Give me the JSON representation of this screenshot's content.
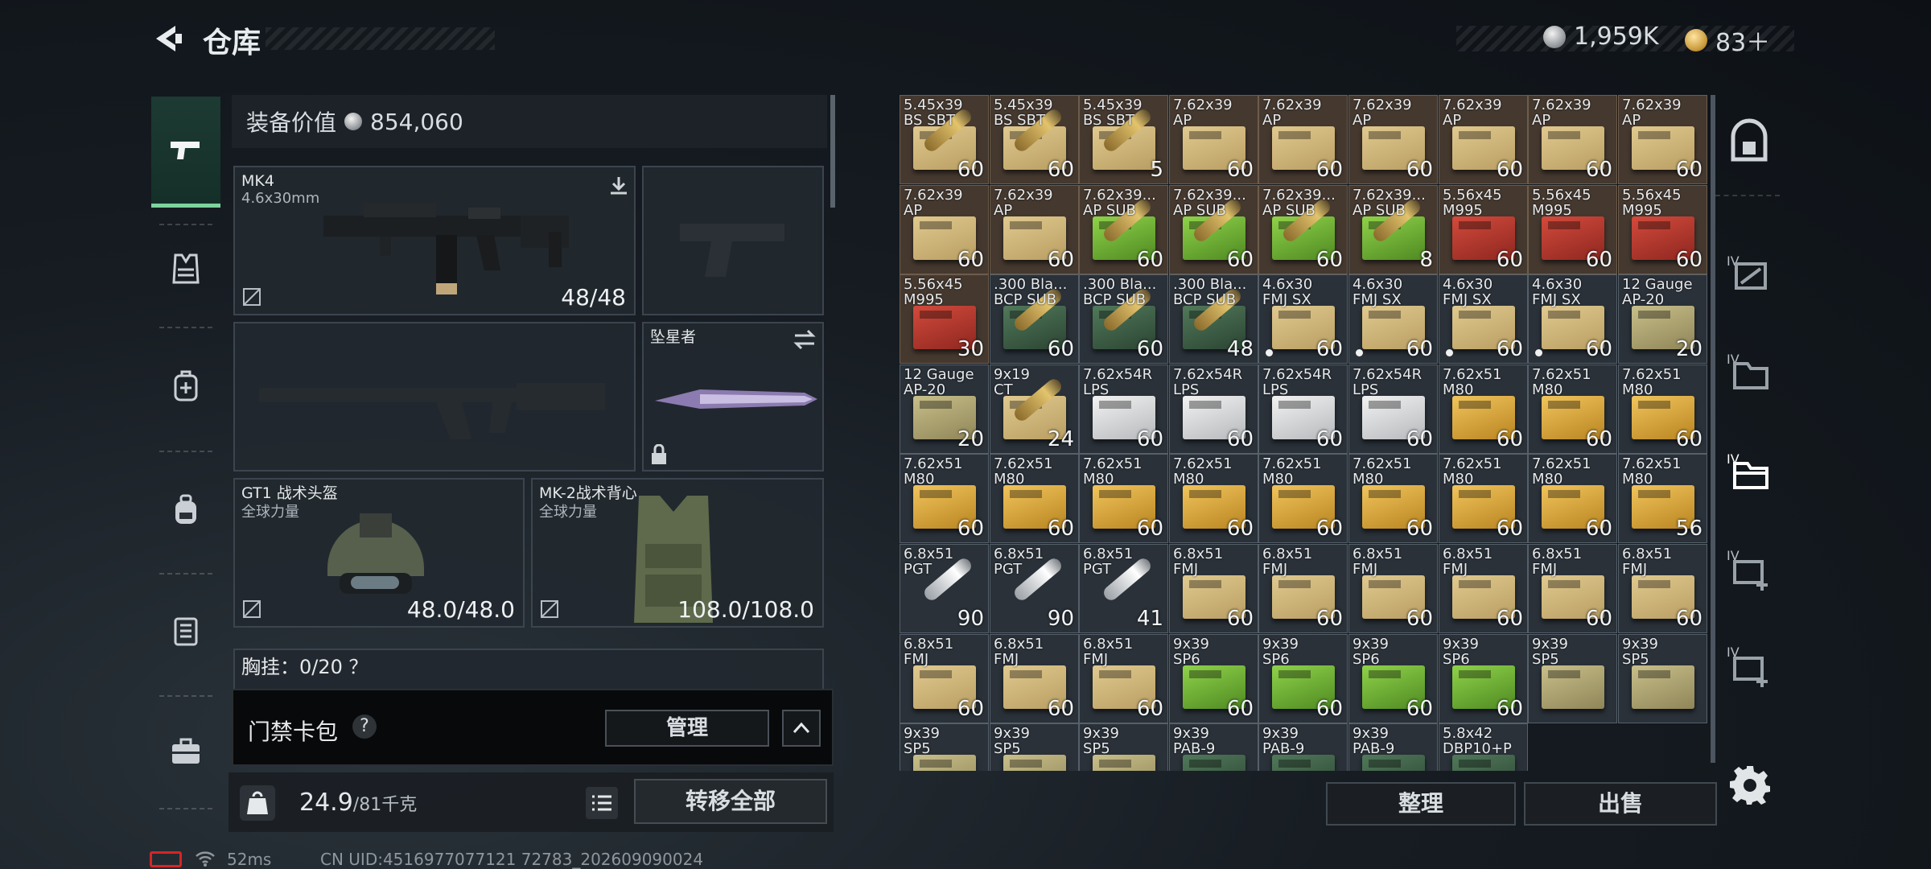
{
  "header": {
    "title": "仓库",
    "currency": [
      {
        "icon": "silver-coin-icon",
        "value": "1,959K"
      },
      {
        "icon": "gold-coin-icon",
        "value": "83＋"
      }
    ]
  },
  "left_nav": [
    {
      "icon": "pistol-icon",
      "selected": true
    },
    {
      "icon": "vest-icon"
    },
    {
      "icon": "backpack-medical-icon"
    },
    {
      "icon": "backpack-icon"
    },
    {
      "icon": "container-icon"
    },
    {
      "icon": "case-icon"
    }
  ],
  "equipment": {
    "value_label": "装备价值",
    "value": "854,060",
    "primary": {
      "name": "MK4",
      "caliber": "4.6x30mm",
      "ammo": "48/48"
    },
    "melee": {
      "name": "坠星者"
    },
    "helmet": {
      "name": "GT1 战术头盔",
      "brand": "全球力量",
      "durability": "48.0/48.0"
    },
    "armor": {
      "name": "MK-2战术背心",
      "brand": "全球力量",
      "durability": "108.0/108.0"
    },
    "chest_partial": "胸挂：0/20  ？"
  },
  "card_bag": {
    "label": "门禁卡包",
    "help": "?",
    "manage": "管理"
  },
  "bottom_bar": {
    "weight": "24.9",
    "weight_cap": "/81千克",
    "transfer_all": "转移全部"
  },
  "status": {
    "ping": "52ms",
    "uid": "CN UID:4516977077121 72783_202609090024"
  },
  "inventory": [
    {
      "n": "5.45x39\nBS SBT",
      "q": "60",
      "box": "bullet",
      "hl": true
    },
    {
      "n": "5.45x39\nBS SBT",
      "q": "60",
      "box": "bullet",
      "hl": true
    },
    {
      "n": "5.45x39\nBS SBT",
      "q": "5",
      "box": "bullet",
      "hl": true
    },
    {
      "n": "7.62x39\nAP",
      "q": "60",
      "box": "tan",
      "hl": true
    },
    {
      "n": "7.62x39\nAP",
      "q": "60",
      "box": "tan",
      "hl": true
    },
    {
      "n": "7.62x39\nAP",
      "q": "60",
      "box": "tan",
      "hl": true
    },
    {
      "n": "7.62x39\nAP",
      "q": "60",
      "box": "tan",
      "hl": true
    },
    {
      "n": "7.62x39\nAP",
      "q": "60",
      "box": "tan",
      "hl": true
    },
    {
      "n": "7.62x39\nAP",
      "q": "60",
      "box": "tan",
      "hl": true
    },
    {
      "n": "7.62x39\nAP",
      "q": "60",
      "box": "tan",
      "hl": true
    },
    {
      "n": "7.62x39\nAP",
      "q": "60",
      "box": "tan",
      "hl": true
    },
    {
      "n": "7.62x39...\nAP SUB",
      "q": "60",
      "box": "bullet-green",
      "hl": true
    },
    {
      "n": "7.62x39...\nAP SUB",
      "q": "60",
      "box": "bullet-green",
      "hl": true
    },
    {
      "n": "7.62x39...\nAP SUB",
      "q": "60",
      "box": "bullet-green",
      "hl": true
    },
    {
      "n": "7.62x39...\nAP SUB",
      "q": "8",
      "box": "bullet-green",
      "hl": true
    },
    {
      "n": "5.56x45\nM995",
      "q": "60",
      "box": "red",
      "hl": true
    },
    {
      "n": "5.56x45\nM995",
      "q": "60",
      "box": "red",
      "hl": true
    },
    {
      "n": "5.56x45\nM995",
      "q": "60",
      "box": "red",
      "hl": true
    },
    {
      "n": "5.56x45\nM995",
      "q": "30",
      "box": "red",
      "hl": true
    },
    {
      "n": ".300 Bla...\nBCP SUB",
      "q": "60",
      "box": "bullet-dark",
      "hl": false
    },
    {
      "n": ".300 Bla...\nBCP SUB",
      "q": "60",
      "box": "bullet-dark",
      "hl": false
    },
    {
      "n": ".300 Bla...\nBCP SUB",
      "q": "48",
      "box": "bullet-dark",
      "hl": false
    },
    {
      "n": "4.6x30\nFMJ SX",
      "q": "60",
      "box": "tan",
      "hl": false,
      "dot": true
    },
    {
      "n": "4.6x30\nFMJ SX",
      "q": "60",
      "box": "tan",
      "hl": false,
      "dot": true
    },
    {
      "n": "4.6x30\nFMJ SX",
      "q": "60",
      "box": "tan",
      "hl": false,
      "dot": true
    },
    {
      "n": "4.6x30\nFMJ SX",
      "q": "60",
      "box": "tan",
      "hl": false,
      "dot": true
    },
    {
      "n": "12 Gauge\nAP-20",
      "q": "20",
      "box": "olive",
      "hl": false
    },
    {
      "n": "12 Gauge\nAP-20",
      "q": "20",
      "box": "olive",
      "hl": false
    },
    {
      "n": "9x19\nCT",
      "q": "24",
      "box": "bullet",
      "hl": false
    },
    {
      "n": "7.62x54R\nLPS",
      "q": "60",
      "box": "white",
      "hl": false
    },
    {
      "n": "7.62x54R\nLPS",
      "q": "60",
      "box": "white",
      "hl": false
    },
    {
      "n": "7.62x54R\nLPS",
      "q": "60",
      "box": "white",
      "hl": false
    },
    {
      "n": "7.62x54R\nLPS",
      "q": "60",
      "box": "white",
      "hl": false
    },
    {
      "n": "7.62x51\nM80",
      "q": "60",
      "box": "gold",
      "hl": false
    },
    {
      "n": "7.62x51\nM80",
      "q": "60",
      "box": "gold",
      "hl": false
    },
    {
      "n": "7.62x51\nM80",
      "q": "60",
      "box": "gold",
      "hl": false
    },
    {
      "n": "7.62x51\nM80",
      "q": "60",
      "box": "gold",
      "hl": false
    },
    {
      "n": "7.62x51\nM80",
      "q": "60",
      "box": "gold",
      "hl": false
    },
    {
      "n": "7.62x51\nM80",
      "q": "60",
      "box": "gold",
      "hl": false
    },
    {
      "n": "7.62x51\nM80",
      "q": "60",
      "box": "gold",
      "hl": false
    },
    {
      "n": "7.62x51\nM80",
      "q": "60",
      "box": "gold",
      "hl": false
    },
    {
      "n": "7.62x51\nM80",
      "q": "60",
      "box": "gold",
      "hl": false
    },
    {
      "n": "7.62x51\nM80",
      "q": "60",
      "box": "gold",
      "hl": false
    },
    {
      "n": "7.62x51\nM80",
      "q": "60",
      "box": "gold",
      "hl": false
    },
    {
      "n": "7.62x51\nM80",
      "q": "56",
      "box": "gold",
      "hl": false
    },
    {
      "n": "6.8x51\nPGT",
      "q": "90",
      "box": "bullet-silver",
      "hl": false
    },
    {
      "n": "6.8x51\nPGT",
      "q": "90",
      "box": "bullet-silver",
      "hl": false
    },
    {
      "n": "6.8x51\nPGT",
      "q": "41",
      "box": "bullet-silver",
      "hl": false
    },
    {
      "n": "6.8x51\nFMJ",
      "q": "60",
      "box": "tan",
      "hl": false
    },
    {
      "n": "6.8x51\nFMJ",
      "q": "60",
      "box": "tan",
      "hl": false
    },
    {
      "n": "6.8x51\nFMJ",
      "q": "60",
      "box": "tan",
      "hl": false
    },
    {
      "n": "6.8x51\nFMJ",
      "q": "60",
      "box": "tan",
      "hl": false
    },
    {
      "n": "6.8x51\nFMJ",
      "q": "60",
      "box": "tan",
      "hl": false
    },
    {
      "n": "6.8x51\nFMJ",
      "q": "60",
      "box": "tan",
      "hl": false
    },
    {
      "n": "6.8x51\nFMJ",
      "q": "60",
      "box": "tan",
      "hl": false
    },
    {
      "n": "6.8x51\nFMJ",
      "q": "60",
      "box": "tan",
      "hl": false
    },
    {
      "n": "6.8x51\nFMJ",
      "q": "60",
      "box": "tan",
      "hl": false
    },
    {
      "n": "9x39\nSP6",
      "q": "60",
      "box": "green",
      "hl": false
    },
    {
      "n": "9x39\nSP6",
      "q": "60",
      "box": "green",
      "hl": false
    },
    {
      "n": "9x39\nSP6",
      "q": "60",
      "box": "green",
      "hl": false
    },
    {
      "n": "9x39\nSP6",
      "q": "60",
      "box": "green",
      "hl": false
    },
    {
      "n": "9x39\nSP5",
      "q": "",
      "box": "olive",
      "hl": false
    },
    {
      "n": "9x39\nSP5",
      "q": "",
      "box": "olive",
      "hl": false
    },
    {
      "n": "9x39\nSP5",
      "q": "",
      "box": "olive",
      "hl": false
    },
    {
      "n": "9x39\nSP5",
      "q": "",
      "box": "olive",
      "hl": false
    },
    {
      "n": "9x39\nSP5",
      "q": "",
      "box": "olive",
      "hl": false
    },
    {
      "n": "9x39\nPAB-9",
      "q": "",
      "box": "dkgreen",
      "hl": false
    },
    {
      "n": "9x39\nPAB-9",
      "q": "",
      "box": "dkgreen",
      "hl": false
    },
    {
      "n": "9x39\nPAB-9",
      "q": "",
      "box": "dkgreen",
      "hl": false
    },
    {
      "n": "5.8x42\nDBP10+P",
      "q": "",
      "box": "dkgreen",
      "hl": false
    }
  ],
  "actions": {
    "sort": "整理",
    "sell": "出售"
  },
  "right_nav": [
    {
      "icon": "safe-box-icon"
    },
    {
      "icon": "tier-4-container-icon",
      "tier": "IV"
    },
    {
      "icon": "tier-4-folder-icon",
      "tier": "IV"
    },
    {
      "icon": "tier-4-folder-selected-icon",
      "tier": "IV"
    },
    {
      "icon": "tier-4-medkit-icon",
      "tier": "IV"
    },
    {
      "icon": "tier-4-medkit-icon",
      "tier": "IV"
    }
  ]
}
